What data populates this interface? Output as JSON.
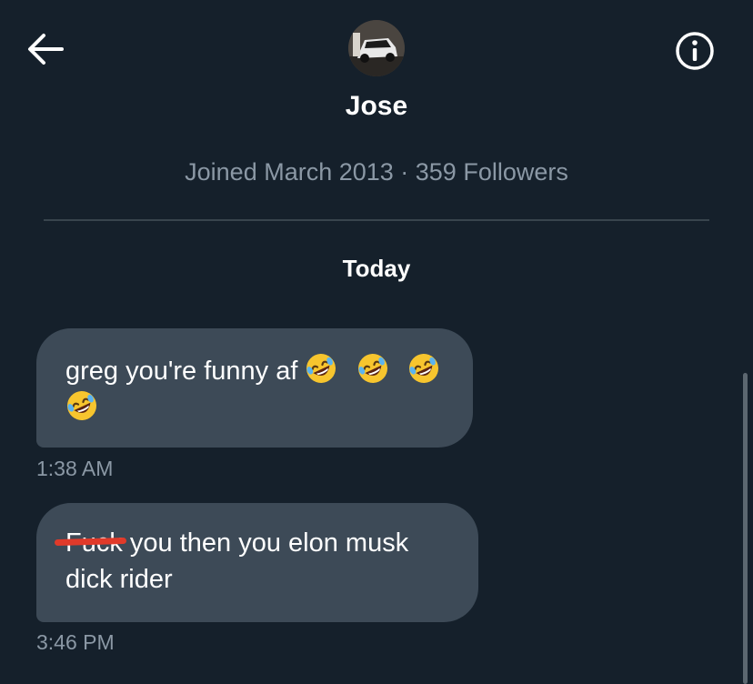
{
  "header": {
    "back_icon": "arrow-left-icon",
    "info_icon": "info-circle-icon",
    "avatar_icon": "car-photo-avatar"
  },
  "profile": {
    "name": "Jose",
    "meta": "Joined March 2013 · 359 Followers"
  },
  "conversation": {
    "date_separator": "Today",
    "messages": [
      {
        "text": "greg you're funny af",
        "emoji": "rolling-on-the-floor-laughing",
        "emoji_count": 4,
        "time": "1:38 AM"
      },
      {
        "struck_word": "Fuck",
        "text_line1": " you then you elon musk",
        "text_line2": "dick rider",
        "time": "3:46 PM"
      }
    ]
  },
  "colors": {
    "background": "#15202b",
    "bubble": "#3d4a57",
    "secondary_text": "#8b98a5",
    "strike_line": "#e03a2a",
    "divider": "#38444d"
  }
}
